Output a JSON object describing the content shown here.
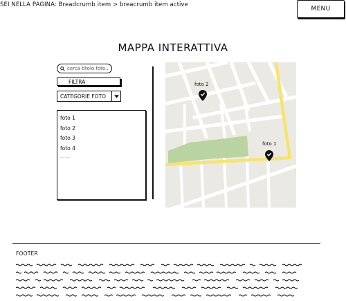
{
  "breadcrumb": {
    "text": "SEI NELLA PAGINA: Breadcrumb item > breacrumb item active"
  },
  "menu": {
    "label": "MENU"
  },
  "page": {
    "title": "MAPPA INTERATTIVA"
  },
  "search": {
    "placeholder": "cerca titolo foto..",
    "icon": "search-icon"
  },
  "filter": {
    "label": "FILTRA"
  },
  "category_select": {
    "selected": "CATEGORIE FOTO",
    "icon": "chevron-down-icon"
  },
  "photo_list": {
    "items": [
      "foto 1",
      "foto 2",
      "foto 3",
      "foto 4"
    ],
    "more": "......"
  },
  "map": {
    "pins": [
      {
        "label": "foto 2",
        "icon": "map-pin-check-icon"
      },
      {
        "label": "foto 1",
        "icon": "map-pin-check-icon"
      }
    ],
    "colors": {
      "land": "#ebe9e3",
      "street": "#ffffff",
      "main_road": "#f7e46a",
      "park": "#b9d4a0",
      "pin": "#111111"
    }
  },
  "footer": {
    "title": "FOOTER"
  }
}
